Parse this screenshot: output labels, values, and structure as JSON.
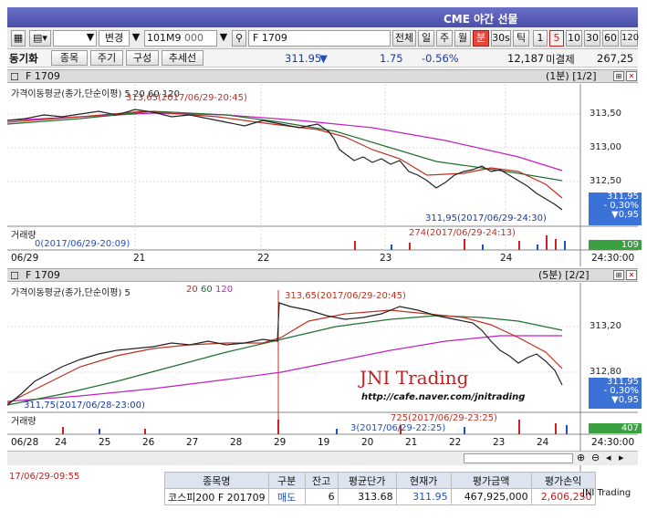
{
  "window": {
    "title": "CME 야간 선물"
  },
  "toolbar": {
    "combo1": "",
    "mode": "변경",
    "code": "101M9",
    "code_suffix": "000",
    "symbol": "F 1709",
    "btn_all": "전체",
    "btn_day": "일",
    "btn_week": "주",
    "btn_month": "월",
    "btn_min": "분",
    "btn_30s": "30s",
    "btn_tick": "틱",
    "periods": [
      "1",
      "5",
      "10",
      "30",
      "60",
      "120"
    ]
  },
  "quote": {
    "sync": "동기화",
    "btn_item": "종목",
    "btn_period": "주기",
    "btn_config": "구성",
    "btn_trend": "추세선",
    "price": "311.95",
    "arrow": "▼",
    "change": "1.75",
    "pct": "-0.56%",
    "volume": "12,187",
    "oi_label": "미결제",
    "oi": "267,25"
  },
  "pane1": {
    "symbol": "F 1709",
    "period": "(1분) [1/2]",
    "ma_label": "가격이동평균(종가,단순이평) 5 20 60 120",
    "hi_label": "313,65(2017/06/29-20:45)",
    "lo_label": "311,95(2017/06/29-24:30)",
    "yticks": [
      "313,50",
      "313,00",
      "312,50"
    ],
    "price_box": [
      "311,95",
      "- 0,30%",
      "▼0,95"
    ],
    "vol_label": "거래량",
    "vol_lo": "0(2017/06/29-20:09)",
    "vol_hi": "274(2017/06/29-24:13)",
    "vol_val": "109",
    "xticks": [
      "06/29",
      "21",
      "22",
      "23",
      "24",
      "24:30:00"
    ]
  },
  "pane2": {
    "symbol": "F 1709",
    "period": "(5분) [2/2]",
    "ma_label": "가격이동평균(종가,단순이평) 5",
    "ma_periods": [
      "20",
      "60",
      "120"
    ],
    "hi_label": "313,65(2017/06/29-20:45)",
    "lo_label": "311,75(2017/06/28-23:00)",
    "yticks": [
      "313,20",
      "312,80"
    ],
    "price_box": [
      "311,95",
      "- 0,30%",
      "▼0,95"
    ],
    "vol_label": "거래량",
    "vol_hi": "725(2017/06/29-23:25)",
    "vol_lo": "3(2017/06/29-22:25)",
    "vol_val": "407",
    "xticks": [
      "06/28",
      "24",
      "25",
      "26",
      "27",
      "28",
      "29",
      "19",
      "20",
      "21",
      "22",
      "23",
      "24",
      "24:30:00"
    ],
    "watermark": "JNI Trading",
    "url": "http://cafe.naver.com/jnitrading"
  },
  "bottom": {
    "left_time": "17/06/29-09:55",
    "headers": [
      "종목명",
      "구분",
      "잔고",
      "평균단가",
      "현재가",
      "평가금액",
      "평가손익"
    ],
    "row": [
      "코스피200 F 201709",
      "매도",
      "6",
      "313.68",
      "311.95",
      "467,925,000",
      "2,606,250"
    ],
    "overlay": "JNI Trading"
  },
  "colors": {
    "titlebar": "#4a4fa8",
    "ma5": "#222222",
    "ma20": "#c03020",
    "ma60": "#207030",
    "ma120": "#c020c0",
    "up": "#d02020",
    "down": "#2050c0"
  }
}
